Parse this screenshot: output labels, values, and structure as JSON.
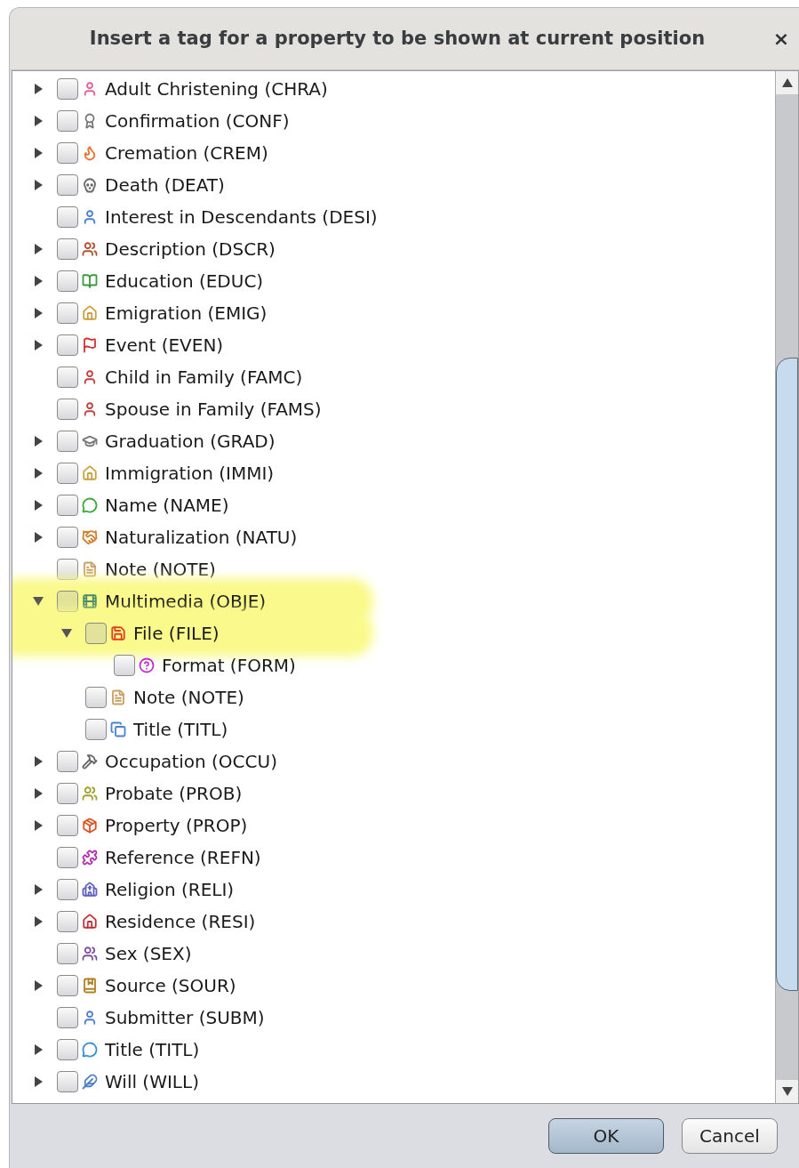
{
  "dialog": {
    "title": "Insert a tag for a property to be shown at current position",
    "close": "×"
  },
  "tree": [
    {
      "label": "Adult Christening (CHRA)",
      "expanded": false,
      "checked": false,
      "highlighted": false
    },
    {
      "label": "Confirmation (CONF)",
      "expanded": false,
      "checked": false,
      "highlighted": false
    },
    {
      "label": "Cremation (CREM)",
      "expanded": false,
      "checked": false,
      "highlighted": false
    },
    {
      "label": "Death (DEAT)",
      "expanded": false,
      "checked": false,
      "highlighted": false
    },
    {
      "label": "Interest in Descendants (DESI)",
      "checked": false,
      "highlighted": false
    },
    {
      "label": "Description (DSCR)",
      "expanded": false,
      "checked": false,
      "highlighted": false
    },
    {
      "label": "Education (EDUC)",
      "expanded": false,
      "checked": false,
      "highlighted": false
    },
    {
      "label": "Emigration (EMIG)",
      "expanded": false,
      "checked": false,
      "highlighted": false
    },
    {
      "label": "Event (EVEN)",
      "expanded": false,
      "checked": false,
      "highlighted": false
    },
    {
      "label": "Child in Family (FAMC)",
      "checked": false,
      "highlighted": false
    },
    {
      "label": "Spouse in Family (FAMS)",
      "checked": false,
      "highlighted": false
    },
    {
      "label": "Graduation (GRAD)",
      "expanded": false,
      "checked": false,
      "highlighted": false
    },
    {
      "label": "Immigration (IMMI)",
      "expanded": false,
      "checked": false,
      "highlighted": false
    },
    {
      "label": "Name (NAME)",
      "expanded": false,
      "checked": false,
      "highlighted": false
    },
    {
      "label": "Naturalization (NATU)",
      "expanded": false,
      "checked": false,
      "highlighted": false
    },
    {
      "label": "Note (NOTE)",
      "checked": false,
      "highlighted": false
    },
    {
      "label": "Multimedia (OBJE)",
      "expanded": true,
      "checked": false,
      "highlighted": true,
      "children": [
        {
          "label": "File (FILE)",
          "expanded": true,
          "checked": false,
          "highlighted": true,
          "children": [
            {
              "label": "Format (FORM)",
              "checked": false,
              "highlighted": false
            }
          ]
        },
        {
          "label": "Note (NOTE)",
          "checked": false,
          "highlighted": false
        },
        {
          "label": "Title (TITL)",
          "checked": false,
          "highlighted": false
        }
      ]
    },
    {
      "label": "Occupation (OCCU)",
      "expanded": false,
      "checked": false,
      "highlighted": false
    },
    {
      "label": "Probate (PROB)",
      "expanded": false,
      "checked": false,
      "highlighted": false
    },
    {
      "label": "Property (PROP)",
      "expanded": false,
      "checked": false,
      "highlighted": false
    },
    {
      "label": "Reference (REFN)",
      "checked": false,
      "highlighted": false
    },
    {
      "label": "Religion (RELI)",
      "expanded": false,
      "checked": false,
      "highlighted": false
    },
    {
      "label": "Residence (RESI)",
      "expanded": false,
      "checked": false,
      "highlighted": false
    },
    {
      "label": "Sex (SEX)",
      "checked": false,
      "highlighted": false
    },
    {
      "label": "Source (SOUR)",
      "expanded": false,
      "checked": false,
      "highlighted": false
    },
    {
      "label": "Submitter (SUBM)",
      "checked": false,
      "highlighted": false
    },
    {
      "label": "Title (TITL)",
      "expanded": false,
      "checked": false,
      "highlighted": false
    },
    {
      "label": "Will (WILL)",
      "expanded": false,
      "checked": false,
      "highlighted": false
    }
  ],
  "buttons": [
    {
      "label": "OK",
      "kind": "default"
    },
    {
      "label": "Cancel",
      "kind": "normal"
    }
  ]
}
